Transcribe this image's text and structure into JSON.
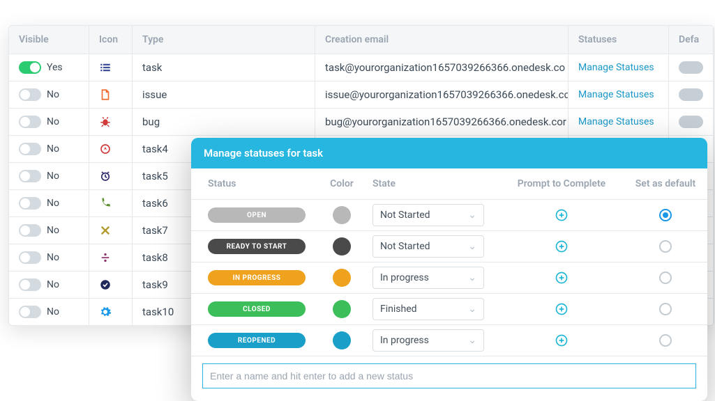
{
  "table": {
    "headers": {
      "visible": "Visible",
      "icon": "Icon",
      "type": "Type",
      "email": "Creation email",
      "statuses": "Statuses",
      "default": "Defa"
    },
    "status_link_label": "Manage Statuses",
    "visible_yes": "Yes",
    "visible_no": "No",
    "rows": [
      {
        "on": true,
        "icon": "list-icon",
        "icon_color": "#3b4f9b",
        "type": "task",
        "email": "task@yourorganization1657039266366.onedesk.co"
      },
      {
        "on": false,
        "icon": "file-icon",
        "icon_color": "#ef6a2f",
        "type": "issue",
        "email": "issue@yourorganization1657039266366.onedesk.cc"
      },
      {
        "on": false,
        "icon": "bug-icon",
        "icon_color": "#d23b3b",
        "type": "bug",
        "email": "bug@yourorganization1657039266366.onedesk.cor"
      },
      {
        "on": false,
        "icon": "target-icon",
        "icon_color": "#d23b3b",
        "type": "task4",
        "email": ""
      },
      {
        "on": false,
        "icon": "alarm-icon",
        "icon_color": "#2c2a6b",
        "type": "task5",
        "email": ""
      },
      {
        "on": false,
        "icon": "phone-icon",
        "icon_color": "#5a8f2e",
        "type": "task6",
        "email": ""
      },
      {
        "on": false,
        "icon": "x-icon",
        "icon_color": "#b39a2e",
        "type": "task7",
        "email": ""
      },
      {
        "on": false,
        "icon": "divide-icon",
        "icon_color": "#8a2d6b",
        "type": "task8",
        "email": ""
      },
      {
        "on": false,
        "icon": "check-circle-icon",
        "icon_color": "#1f2a5b",
        "type": "task9",
        "email": ""
      },
      {
        "on": false,
        "icon": "gear-icon",
        "icon_color": "#1a97e6",
        "type": "task10",
        "email": ""
      }
    ]
  },
  "modal": {
    "title": "Manage statuses for task",
    "headers": {
      "status": "Status",
      "color": "Color",
      "state": "State",
      "prompt": "Prompt to Complete",
      "default": "Set as default"
    },
    "rows": [
      {
        "label": "OPEN",
        "color": "#b8b8b8",
        "state": "Not Started",
        "default": true
      },
      {
        "label": "READY TO START",
        "color": "#4a4a4a",
        "state": "Not Started",
        "default": false
      },
      {
        "label": "IN PROGRESS",
        "color": "#efa21e",
        "state": "In progress",
        "default": false
      },
      {
        "label": "CLOSED",
        "color": "#3cbf5a",
        "state": "Finished",
        "default": false
      },
      {
        "label": "REOPENED",
        "color": "#1a9fc9",
        "state": "In progress",
        "default": false
      }
    ],
    "input_placeholder": "Enter a name and hit enter to add a new status"
  },
  "icons": {
    "list-icon": "<svg viewBox='0 0 24 24' width='18' height='18'><g fill='COLOR'><rect x='3' y='5' width='3' height='3'/><rect x='8' y='5' width='13' height='3'/><rect x='3' y='10.5' width='3' height='3'/><rect x='8' y='10.5' width='13' height='3'/><rect x='3' y='16' width='3' height='3'/><rect x='8' y='16' width='13' height='3'/></g></svg>",
    "file-icon": "<svg viewBox='0 0 24 24' width='18' height='18'><path fill='none' stroke='COLOR' stroke-width='2.2' d='M6 3h8l4 4v14H6z'/><path fill='none' stroke='COLOR' stroke-width='2.2' d='M14 3v4h4'/></svg>",
    "bug-icon": "<svg viewBox='0 0 24 24' width='18' height='18'><g fill='COLOR'><ellipse cx='12' cy='13' rx='5' ry='6'/><path d='M9 6l-2-3M15 6l2-3M7 13H3M17 13h4M8 18l-3 3M16 18l3 3' stroke='COLOR' stroke-width='2' fill='none'/></g></svg>",
    "target-icon": "<svg viewBox='0 0 24 24' width='18' height='18'><circle cx='12' cy='12' r='8' fill='none' stroke='COLOR' stroke-width='2.2'/><path d='M12 8l3 6-3-2-3 2z' fill='COLOR'/></svg>",
    "alarm-icon": "<svg viewBox='0 0 24 24' width='18' height='18'><circle cx='12' cy='13' r='7' fill='none' stroke='COLOR' stroke-width='2.2'/><path d='M12 9v4l3 2M5 4l3 2M19 4l-3 2' stroke='COLOR' stroke-width='2.2' fill='none'/></svg>",
    "phone-icon": "<svg viewBox='0 0 24 24' width='18' height='18'><path fill='COLOR' d='M6 3c0 9 6 15 15 15v-4l-5-1-2 2c-3-1-5-3-6-6l2-2-1-5H6z'/></svg>",
    "x-icon": "<svg viewBox='0 0 24 24' width='18' height='18'><path stroke='COLOR' stroke-width='3.2' d='M5 5l14 14M19 5L5 19'/></svg>",
    "divide-icon": "<svg viewBox='0 0 24 24' width='18' height='18'><g fill='COLOR'><circle cx='12' cy='6' r='2.2'/><rect x='5' y='11' width='14' height='2.2'/><circle cx='12' cy='18' r='2.2'/></g></svg>",
    "check-circle-icon": "<svg viewBox='0 0 24 24' width='18' height='18'><circle cx='12' cy='12' r='9' fill='COLOR'/><path d='M8 12l3 3 5-6' stroke='#fff' stroke-width='2.2' fill='none'/></svg>",
    "gear-icon": "<svg viewBox='0 0 24 24' width='18' height='18'><path fill='COLOR' d='M12 8a4 4 0 100 8 4 4 0 000-8zm9 4l2 1-1 3-2-.5a8 8 0 01-1.5 1.5l.5 2-3 1-1-2a8 8 0 01-2 0l-1 2-3-1 .5-2A8 8 0 017 16.5L5 17l-1-3 2-1a8 8 0 010-2l-2-1 1-3 2 .5A8 8 0 018.5 6L8 4l3-1 1 2a8 8 0 012 0l1-2 3 1-.5 2A8 8 0 0119 7.5l2-.5 1 3-2 1a8 8 0 010 2z'/></svg>",
    "plus-circle": "<svg viewBox='0 0 24 24' width='20' height='20'><circle cx='12' cy='12' r='9' fill='none' stroke='#1fb7d6' stroke-width='2'/><path d='M12 8v8M8 12h8' stroke='#1fb7d6' stroke-width='2'/></svg>"
  }
}
